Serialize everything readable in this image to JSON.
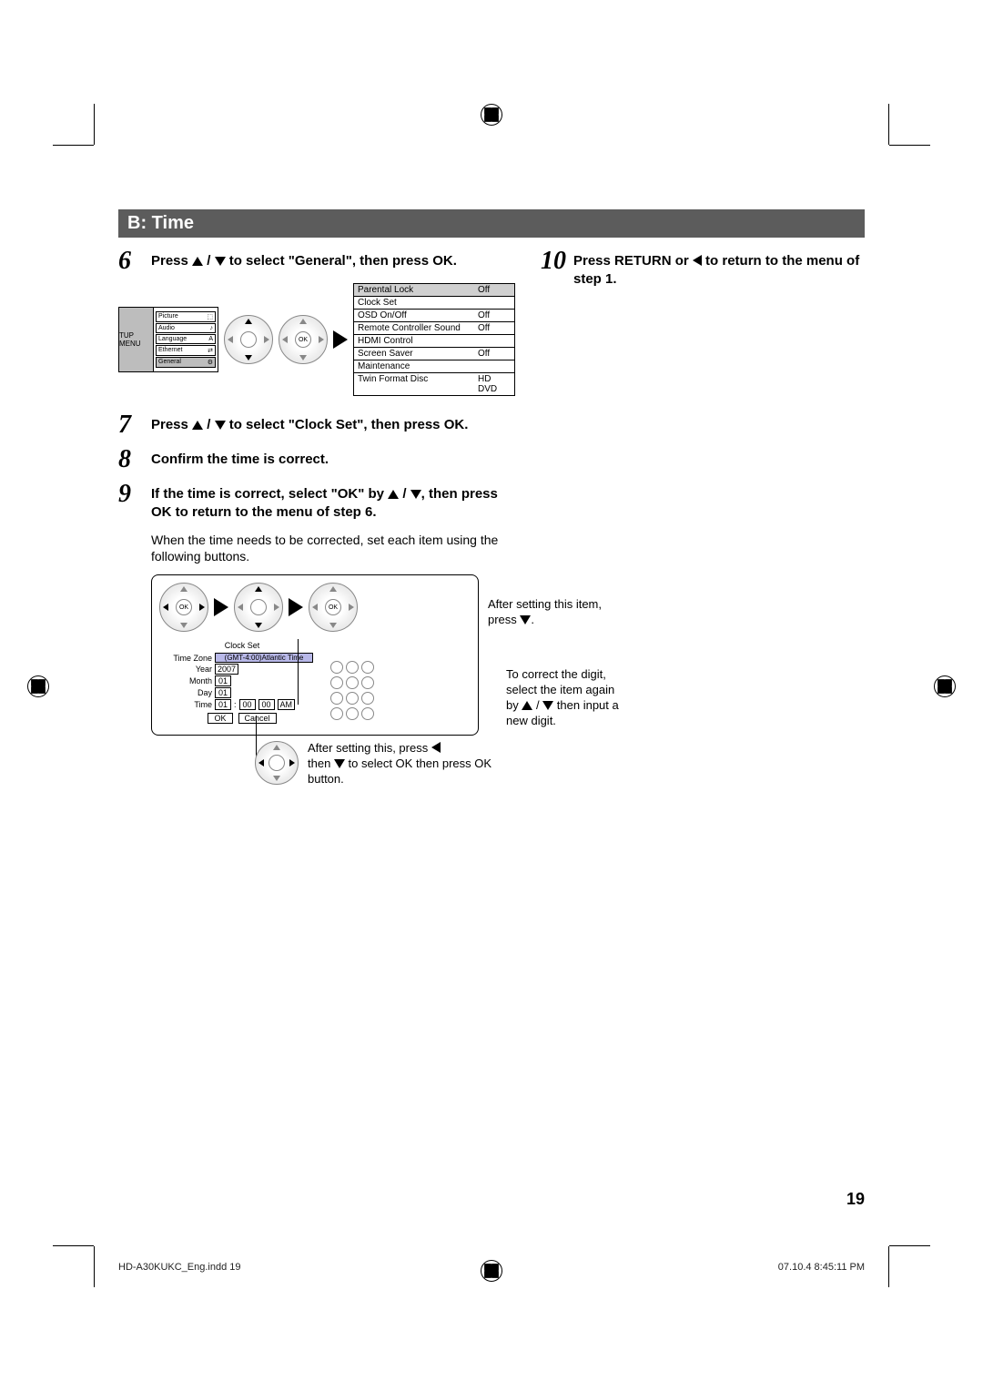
{
  "section_title": "B: Time",
  "steps": {
    "s6": {
      "num": "6",
      "text_a": "Press ",
      "text_b": " / ",
      "text_c": " to select \"General\", then press OK."
    },
    "s7": {
      "num": "7",
      "text_a": "Press ",
      "text_b": " / ",
      "text_c": " to select \"Clock Set\", then press OK."
    },
    "s8": {
      "num": "8",
      "text": "Confirm the time is correct."
    },
    "s9": {
      "num": "9",
      "text_a": "If the time is correct, select \"OK\" by ",
      "text_b": " / ",
      "text_c": ", then press OK to return to the menu of step 6."
    },
    "s10": {
      "num": "10",
      "text_a": "Press RETURN or ",
      "text_b": " to return to the menu of step 1."
    }
  },
  "body_after_9": "When the time needs to be corrected, set each item using the following buttons.",
  "setup_menu": {
    "label": "TUP MENU",
    "items": [
      "Picture",
      "Audio",
      "Language",
      "Ethernet",
      "General"
    ],
    "selected": "General"
  },
  "settings": {
    "rows": [
      {
        "label": "Parental Lock",
        "val": "Off",
        "sel": true
      },
      {
        "label": "Clock Set",
        "val": ""
      },
      {
        "label": "OSD On/Off",
        "val": "Off"
      },
      {
        "label": "Remote Controller Sound",
        "val": "Off"
      },
      {
        "label": "HDMI Control",
        "val": ""
      },
      {
        "label": "Screen Saver",
        "val": "Off"
      },
      {
        "label": "Maintenance",
        "val": ""
      },
      {
        "label": "Twin Format Disc",
        "val": "HD DVD"
      }
    ]
  },
  "ok_label": "OK",
  "after_setting_note": "After setting this item, press ",
  "clock_set": {
    "title": "Clock Set",
    "time_zone_label": "Time Zone",
    "time_zone_value": "(GMT-4:00)Atlantic Time",
    "year_label": "Year",
    "year_value": "2007",
    "month_label": "Month",
    "month_value": "01",
    "day_label": "Day",
    "day_value": "01",
    "time_label": "Time",
    "time_h": "01",
    "time_m": "00",
    "time_s": "00",
    "time_ampm": "AM",
    "ok": "OK",
    "cancel": "Cancel"
  },
  "correct_digit_note_1": "To correct the digit,",
  "correct_digit_note_2": "select the item again",
  "correct_digit_note_3": "by ",
  "correct_digit_note_4": " / ",
  "correct_digit_note_5": " then input a",
  "correct_digit_note_6": "new digit.",
  "after_setting_this_1": "After setting this, press ",
  "after_setting_this_2": "then ",
  "after_setting_this_3": " to select  OK  then press OK button.",
  "page_number": "19",
  "footer_left": "HD-A30KUKC_Eng.indd   19",
  "footer_right": "07.10.4   8:45:11 PM"
}
